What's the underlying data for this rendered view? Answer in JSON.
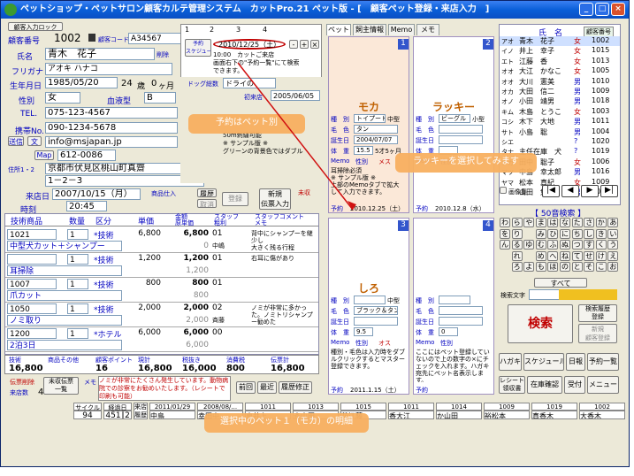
{
  "title": "ペットショップ・ペットサロン顧客カルテ管理システム　カットPro.21 ペット版 - [　顧客ペット登録・来店入力　]",
  "window_controls": [
    "_",
    "□",
    "×"
  ],
  "customer": {
    "add_label": "顧客入力ロック",
    "id_label": "顧客番号",
    "id_value": "1002",
    "code_label": "顧客コード",
    "code_value": "A34567",
    "name_label": "氏名",
    "name_value": "青木　花子",
    "delete_label": "削除",
    "kana_label": "フリガナ",
    "kana_value": "アオキ ハナコ",
    "dob_label": "生年月日",
    "dob_value": "1985/05/20",
    "age_value": "24",
    "age_unit": "歳",
    "months_value": "0",
    "months_unit": "ヶ月",
    "gender_label": "性別",
    "gender_value": "女",
    "blood_label": "血液型",
    "blood_value": "B",
    "tel_label": "TEL.",
    "tel_value": "075-123-4567",
    "mobile_label": "携帯No.",
    "mobile_value": "090-1234-5678",
    "mail_btn1": "送信",
    "mail_btn2": "文",
    "mail_value": "info@msjapan.jp",
    "map_label": "Map",
    "zip_value": "612-0086",
    "addr_label": "住所1・2",
    "addr1": "京都市伏見区桃山町真齋",
    "addr2": "1－2－3"
  },
  "visit": {
    "date_label": "来店日",
    "date_value": "2007/10/15（月）",
    "time_label": "時刻",
    "time_value": "20:45",
    "goods_label": "商品仕入",
    "history_label": "履歴",
    "cancel_label": "取消",
    "register_label": "登録",
    "new_slip_label": "新規\n伝票入力",
    "unreg_label": "未収"
  },
  "table": {
    "headers": [
      "技術商品",
      "数量",
      "区分",
      "単価",
      "金額\n原単価",
      "スタッフ\n粗利",
      "スタッフコメント\nメモ"
    ],
    "rows": [
      {
        "code": "1021",
        "qty": "1",
        "kind": "*技術",
        "price": "6,800",
        "amount": "6,800",
        "cost": "0",
        "staff": "01",
        "name": "中型犬カット＋シャンプー",
        "comment": "背中にシャンプーを継少し\n大きく残る行程"
      },
      {
        "code": "",
        "qty": "1",
        "kind": "*技術",
        "price": "1,200",
        "amount": "1,200",
        "cost": "1,200",
        "staff": "01",
        "name": "耳掃除",
        "comment": "右耳に傷があり"
      },
      {
        "code": "1007",
        "qty": "1",
        "kind": "*技術",
        "price": "800",
        "amount": "800",
        "cost": "800",
        "staff": "01",
        "name": "爪カット",
        "comment": ""
      },
      {
        "code": "1050",
        "qty": "1",
        "kind": "*技術",
        "price": "2,000",
        "amount": "2,000",
        "cost": "2,000",
        "staff": "02",
        "name": "ノミ取り",
        "comment": "ノミが非常に多かった。ノミトリシャンプー勧めた"
      },
      {
        "code": "1200",
        "qty": "1",
        "kind": "*ホテル",
        "price": "6,000",
        "amount": "6,000",
        "cost": "6,000",
        "staff": "00",
        "name": "2泊3日",
        "comment": ""
      }
    ],
    "staff_names": [
      "中嶋",
      "",
      "",
      "斉藤",
      ""
    ]
  },
  "totals": {
    "headers": [
      "技術",
      "商品その他",
      "顧客ポイント",
      "現計",
      "税抜き",
      "消費税",
      "伝票計"
    ],
    "values": [
      "16,800",
      "",
      "16",
      "16,800",
      "16,000",
      "800",
      "16,800"
    ]
  },
  "footer": {
    "slip_delete": "伝票削除",
    "unreg_list": "未収伝票\n一覧",
    "memo_label": "メモ",
    "visit_count_label": "来店数",
    "visit_count": "4",
    "memo_text": "ノミが非常にたくさん発生しています。動物病院での診察をお勧めいたします。（レシートで印刷も可能）",
    "prev_label": "前回",
    "recent_label": "最近",
    "history_fix": "履歴修正"
  },
  "pet_tabs": [
    "ペット",
    "飼主情報",
    "Memo",
    "メモ"
  ],
  "schedule": {
    "tabs": [
      "1",
      "2",
      "3",
      "4"
    ],
    "btn": "予約\nスケジュール",
    "date": "2010/12/25（土）",
    "text": "10:00　カットご来店\n画面右下の\"予約一覧\"にて検索\nできます。"
  },
  "pets": [
    {
      "no": "1",
      "name": "モカ",
      "type": "トイプードル",
      "size": "中型",
      "gender": "メス",
      "color": "タン",
      "birth": "2004/07/07",
      "weight": "15.5",
      "age": "5才5ヶ月",
      "memo": "耳掃除必須\n※ サンプル版 ※\n上部のMemoタブで拡大\nして入力できます。",
      "reserve_label": "予約",
      "reserve": "2010.12.25（土）"
    },
    {
      "no": "2",
      "name": "ラッキー",
      "type": "ビーグル",
      "size": "小型",
      "gender": "オス",
      "color": "",
      "birth": "",
      "weight": "",
      "age": "",
      "memo": "",
      "reserve_label": "予約",
      "reserve": "2010.12.8（水）"
    },
    {
      "no": "3",
      "name": "しろ",
      "type": "",
      "size": "中型",
      "gender": "オス",
      "color": "ブラック＆タン",
      "birth": "",
      "weight": "9.5",
      "age": "",
      "memo": "種別・毛色は入力時をダブルクリックするとマスター登録できます。",
      "reserve_label": "予約",
      "reserve": "2011.1.15（土）"
    },
    {
      "no": "4",
      "name": "",
      "type": "",
      "size": "",
      "gender": "",
      "color": "",
      "birth": "",
      "weight": "0",
      "age": "",
      "memo": "ここにはペット登録していないので上の数字の×にチェックを入れます。ハガキ宛先にペット名表示します。",
      "reserve_label": "予約",
      "reserve": ""
    }
  ],
  "pet_field_labels": {
    "type": "種　別",
    "color": "毛　色",
    "birth": "誕生日",
    "weight": "体　重",
    "memo": "Memo",
    "gender": "性別"
  },
  "owner_panel": {
    "label": "ドッグ総数",
    "value1": "ドライの",
    "cat_label": "初来店",
    "cat_value": "2005/06/05",
    "contact_label": "飲み",
    "notes": "50m刺繍可能\n※ サンプル版 ※\nグリーンの背景色ではダブル"
  },
  "customer_list": {
    "headers": [
      "氏　名",
      "顧客番号"
    ],
    "kana_col": [
      "アオ",
      "イノ",
      "エト",
      "オオ",
      "オオ",
      "オカ",
      "オノ",
      "キム",
      "コシ",
      "サト",
      "シエ",
      "タナ",
      "ナカ",
      "マツ",
      "ヤマ"
    ],
    "rows": [
      {
        "name": "青木　花子",
        "sex": "女",
        "id": "1002"
      },
      {
        "name": "井上　幸子",
        "sex": "女",
        "id": "1015"
      },
      {
        "name": "江藤　香",
        "sex": "女",
        "id": "1013"
      },
      {
        "name": "大江　かなこ",
        "sex": "女",
        "id": "1005"
      },
      {
        "name": "大川　憲美",
        "sex": "男",
        "id": "1010"
      },
      {
        "name": "大田　信二",
        "sex": "男",
        "id": "1009"
      },
      {
        "name": "小田　靖男",
        "sex": "男",
        "id": "1018"
      },
      {
        "name": "木島　とうこ",
        "sex": "女",
        "id": "1003"
      },
      {
        "name": "木下　大地",
        "sex": "男",
        "id": "1011"
      },
      {
        "name": "小島　聡",
        "sex": "男",
        "id": "1004"
      },
      {
        "name": "",
        "sex": "?",
        "id": "1020"
      },
      {
        "name": "主任在庫　犬",
        "sex": "?",
        "id": "1019"
      },
      {
        "name": "田中　聡子",
        "sex": "女",
        "id": "1006"
      },
      {
        "name": "中島　幸太郎",
        "sex": "男",
        "id": "1016"
      },
      {
        "name": "松本　真紀",
        "sex": "女",
        "id": "1009"
      },
      {
        "name": "山田　悠",
        "sex": "男",
        "id": "1001"
      }
    ],
    "image_label": "画像集",
    "nav": [
      "|◀",
      "◀",
      "▶",
      "▶|"
    ]
  },
  "kana_search": {
    "title": "【 50音検索 】",
    "grid": [
      "わ",
      "ら",
      "や",
      "ま",
      "は",
      "な",
      "た",
      "さ",
      "か",
      "あ",
      "を",
      "り",
      "",
      "み",
      "ひ",
      "に",
      "ち",
      "し",
      "き",
      "い",
      "ん",
      "る",
      "ゆ",
      "む",
      "ふ",
      "ぬ",
      "つ",
      "す",
      "く",
      "う",
      "",
      "れ",
      "",
      "め",
      "へ",
      "ね",
      "て",
      "せ",
      "け",
      "え",
      "",
      "ろ",
      "よ",
      "も",
      "ほ",
      "の",
      "と",
      "そ",
      "こ",
      "お"
    ],
    "all_label": "すべて",
    "search_text_label": "検索文字",
    "search_btn": "検索",
    "history_btn": "検索履歴\n登録",
    "new_btn": "新規\n顧客登録"
  },
  "bottom_buttons": [
    "ハガキ",
    "スケジュール",
    "日報",
    "予約一覧",
    "レシート\n領収書",
    "在庫確認",
    "受付",
    "メニュー"
  ],
  "status_bar": {
    "cycle_label": "サイクル",
    "cycle_value": "94",
    "elapsed_label": "経過日",
    "elapsed_value": "451",
    "visit_label": "来店\n履歴",
    "visit_count": "2",
    "history": [
      {
        "date": "2011/01/29",
        "name": "中島"
      },
      {
        "date": "2008/08/...",
        "name": "幸田中"
      },
      {
        "date": "1011",
        "name": "恵井上"
      },
      {
        "date": "1013",
        "name": "斉山田"
      },
      {
        "date": "1015",
        "name": "花江藤"
      },
      {
        "date": "1011",
        "name": "香大江"
      },
      {
        "date": "1014",
        "name": "か山田"
      },
      {
        "date": "1009",
        "name": "裕松本"
      },
      {
        "date": "1019",
        "name": "真香木"
      },
      {
        "date": "1002",
        "name": "大香木"
      }
    ]
  },
  "annotations": {
    "a1": "予約はペット別",
    "a2": "ラッキーを選択してみます",
    "a3": "選択中のペット１（モカ）の明細"
  },
  "colors": {
    "title_blue": "#0a5fd8",
    "label_blue": "#0000c0",
    "red": "#c00000",
    "bubble": "#f8b060",
    "pet_bg": "#fbe8d8"
  }
}
